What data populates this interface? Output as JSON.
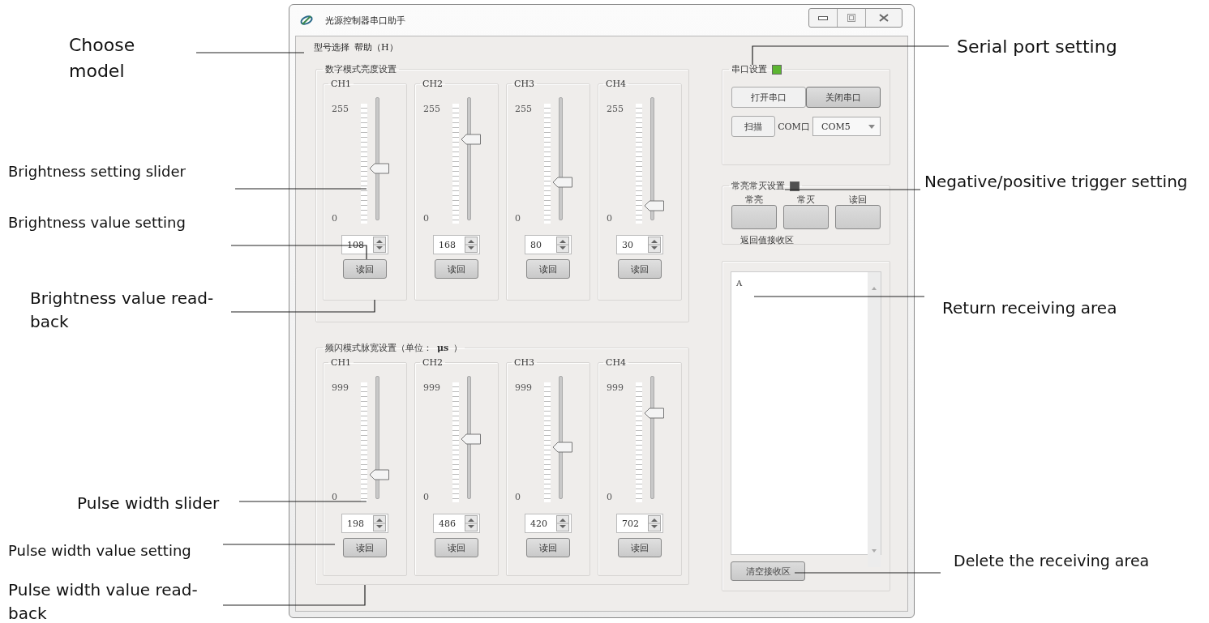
{
  "window": {
    "title": "光源控制器串口助手"
  },
  "menu": [
    "型号选择",
    "帮助（H）"
  ],
  "brightness": {
    "title": "数字模式亮度设置",
    "channels": [
      {
        "name": "CH1",
        "max": "255",
        "min": "0",
        "level": 0.42,
        "value": "108",
        "button": "读回"
      },
      {
        "name": "CH2",
        "max": "255",
        "min": "0",
        "level": 0.66,
        "value": "168",
        "button": "读回"
      },
      {
        "name": "CH3",
        "max": "255",
        "min": "0",
        "level": 0.31,
        "value": "80",
        "button": "读回"
      },
      {
        "name": "CH4",
        "max": "255",
        "min": "0",
        "level": 0.12,
        "value": "30",
        "button": "读回"
      }
    ]
  },
  "pulse": {
    "title": "频闪模式脉宽设置（单位：**μs** ）",
    "channels": [
      {
        "name": "CH1",
        "max": "999",
        "min": "0",
        "level": 0.2,
        "value": "198",
        "button": "读回"
      },
      {
        "name": "CH2",
        "max": "999",
        "min": "0",
        "level": 0.49,
        "value": "486",
        "button": "读回"
      },
      {
        "name": "CH3",
        "max": "999",
        "min": "0",
        "level": 0.42,
        "value": "420",
        "button": "读回"
      },
      {
        "name": "CH4",
        "max": "999",
        "min": "0",
        "level": 0.7,
        "value": "702",
        "button": "读回"
      }
    ]
  },
  "serial": {
    "title": "串口设置",
    "color": "#5cb531",
    "buttons": [
      {
        "label": "打开串口",
        "pressed": false
      },
      {
        "label": "关闭串口",
        "pressed": true
      }
    ],
    "scan": "扫描",
    "port_label": "COM口",
    "port": "COM5"
  },
  "trigger": {
    "title": "常亮常灭设置",
    "color": "#505050",
    "buttons": [
      "常亮",
      "常灭",
      "读回"
    ],
    "receive_label": "返回值接收区"
  },
  "receive": {
    "text": "A",
    "clear": "清空接收区"
  },
  "annotations_left": [
    "Choose model",
    "Brightness setting slider",
    "Brightness value setting",
    "Brightness value read-back",
    "Pulse width slider",
    "Pulse width value setting",
    "Pulse width value read-back"
  ],
  "annotations_right": [
    "Serial port setting",
    "Negative/positive trigger setting",
    "Return receiving area",
    "Delete the receiving area"
  ]
}
